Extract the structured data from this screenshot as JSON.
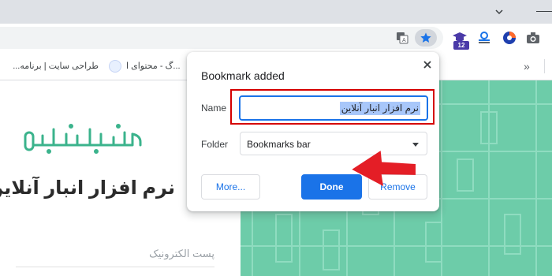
{
  "toolbar": {
    "icons": [
      "translate-icon",
      "bookmark-star-icon",
      "graduation-cap-icon",
      "tracker-icon",
      "vpn-icon",
      "camera-icon"
    ],
    "extension_badge": "12",
    "accent_color": "#1a73e8"
  },
  "bookmarks_bar": {
    "items": [
      {
        "label": "طراحی سایت | برنامه..."
      },
      {
        "label": "...گ - محتوای ا"
      }
    ],
    "overflow": "»"
  },
  "page": {
    "headline": "نرم افزار انبار آنلاین",
    "email_label": "پست الکترونیک",
    "brand_color": "#6dcca9",
    "logo_alt": "انبار آنلاین"
  },
  "dialog": {
    "title": "Bookmark added",
    "name_label": "Name",
    "name_value": "نرم افزار انبار آنلاین",
    "folder_label": "Folder",
    "folder_value": "Bookmarks bar",
    "more_button": "More...",
    "done_button": "Done",
    "remove_button": "Remove"
  },
  "annotation": {
    "highlight_color": "#d50000"
  }
}
